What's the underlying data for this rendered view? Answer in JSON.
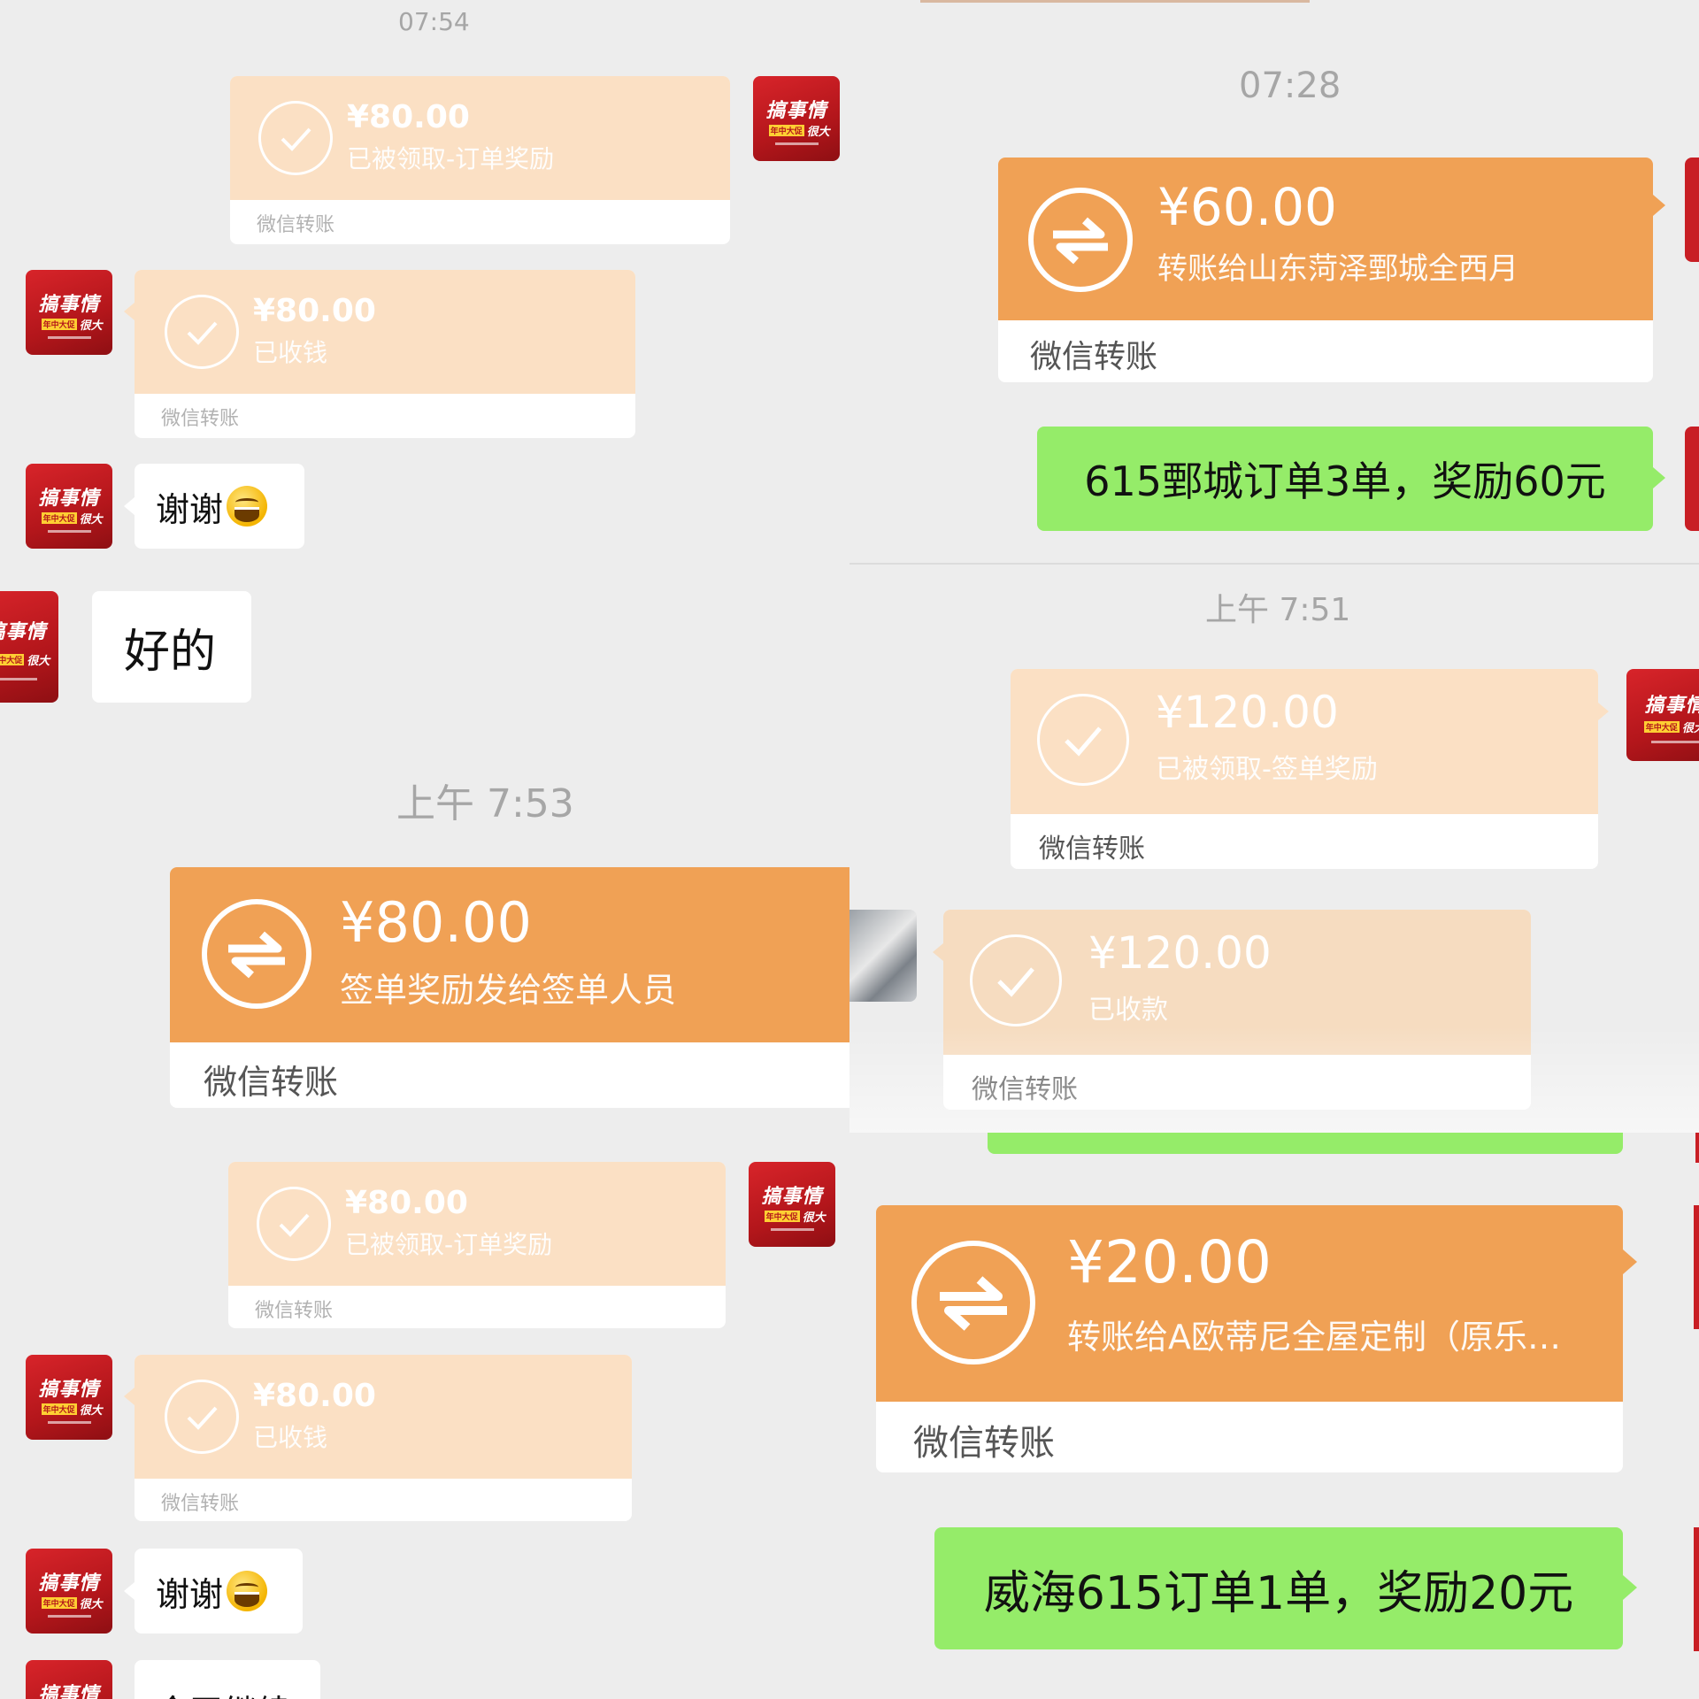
{
  "left": {
    "timestamps": [
      "07:54",
      "上午 7:53"
    ],
    "avatar_text": {
      "line1": "搞事情",
      "tag": "年中大促",
      "line2": "很大"
    },
    "cards": [
      {
        "amount": "¥80.00",
        "desc": "已被领取-订单奖励",
        "footer": "微信转账"
      },
      {
        "amount": "¥80.00",
        "desc": "已收钱",
        "footer": "微信转账"
      },
      {
        "amount": "¥80.00",
        "desc": "签单奖励发给签单人员",
        "footer": "微信转账"
      },
      {
        "amount": "¥80.00",
        "desc": "已被领取-订单奖励",
        "footer": "微信转账"
      },
      {
        "amount": "¥80.00",
        "desc": "已收钱",
        "footer": "微信转账"
      }
    ],
    "messages": [
      "谢谢",
      "好的",
      "谢谢",
      "今天继续"
    ]
  },
  "right_top": {
    "timestamps": [
      "07:28",
      "上午 7:51"
    ],
    "cards": [
      {
        "amount": "¥60.00",
        "desc": "转账给山东菏泽鄄城全西月",
        "footer": "微信转账"
      },
      {
        "amount": "¥120.00",
        "desc": "已被领取-签单奖励",
        "footer": "微信转账"
      },
      {
        "amount": "¥120.00",
        "desc": "已收款",
        "footer": "微信转账"
      }
    ],
    "messages": [
      "615鄄城订单3单，奖励60元"
    ]
  },
  "right_bottom": {
    "cards": [
      {
        "amount": "¥20.00",
        "desc": "转账给A欧蒂尼全屋定制（原乐…",
        "footer": "微信转账"
      }
    ],
    "messages": [
      "威海615订单1单，奖励20元"
    ]
  },
  "colors": {
    "transfer_orange": "#f0a155",
    "received_light": "#fbe0c4",
    "sent_green": "#95ec69",
    "chat_bg": "#ededed"
  }
}
